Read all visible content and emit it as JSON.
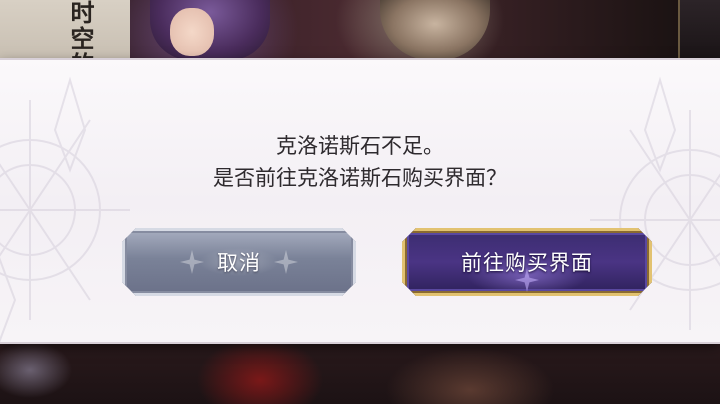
{
  "background": {
    "side_text": "时空的"
  },
  "dialog": {
    "message_line1": "克洛诺斯石不足。",
    "message_line2": "是否前往克洛诺斯石购买界面？",
    "cancel_label": "取消",
    "confirm_label": "前往购买界面"
  },
  "colors": {
    "dialog_bg": "#f7f4f7",
    "cancel_button": "#7a8298",
    "confirm_button": "#4a3484",
    "confirm_border": "#e2c270",
    "text": "#2e2a2e"
  }
}
